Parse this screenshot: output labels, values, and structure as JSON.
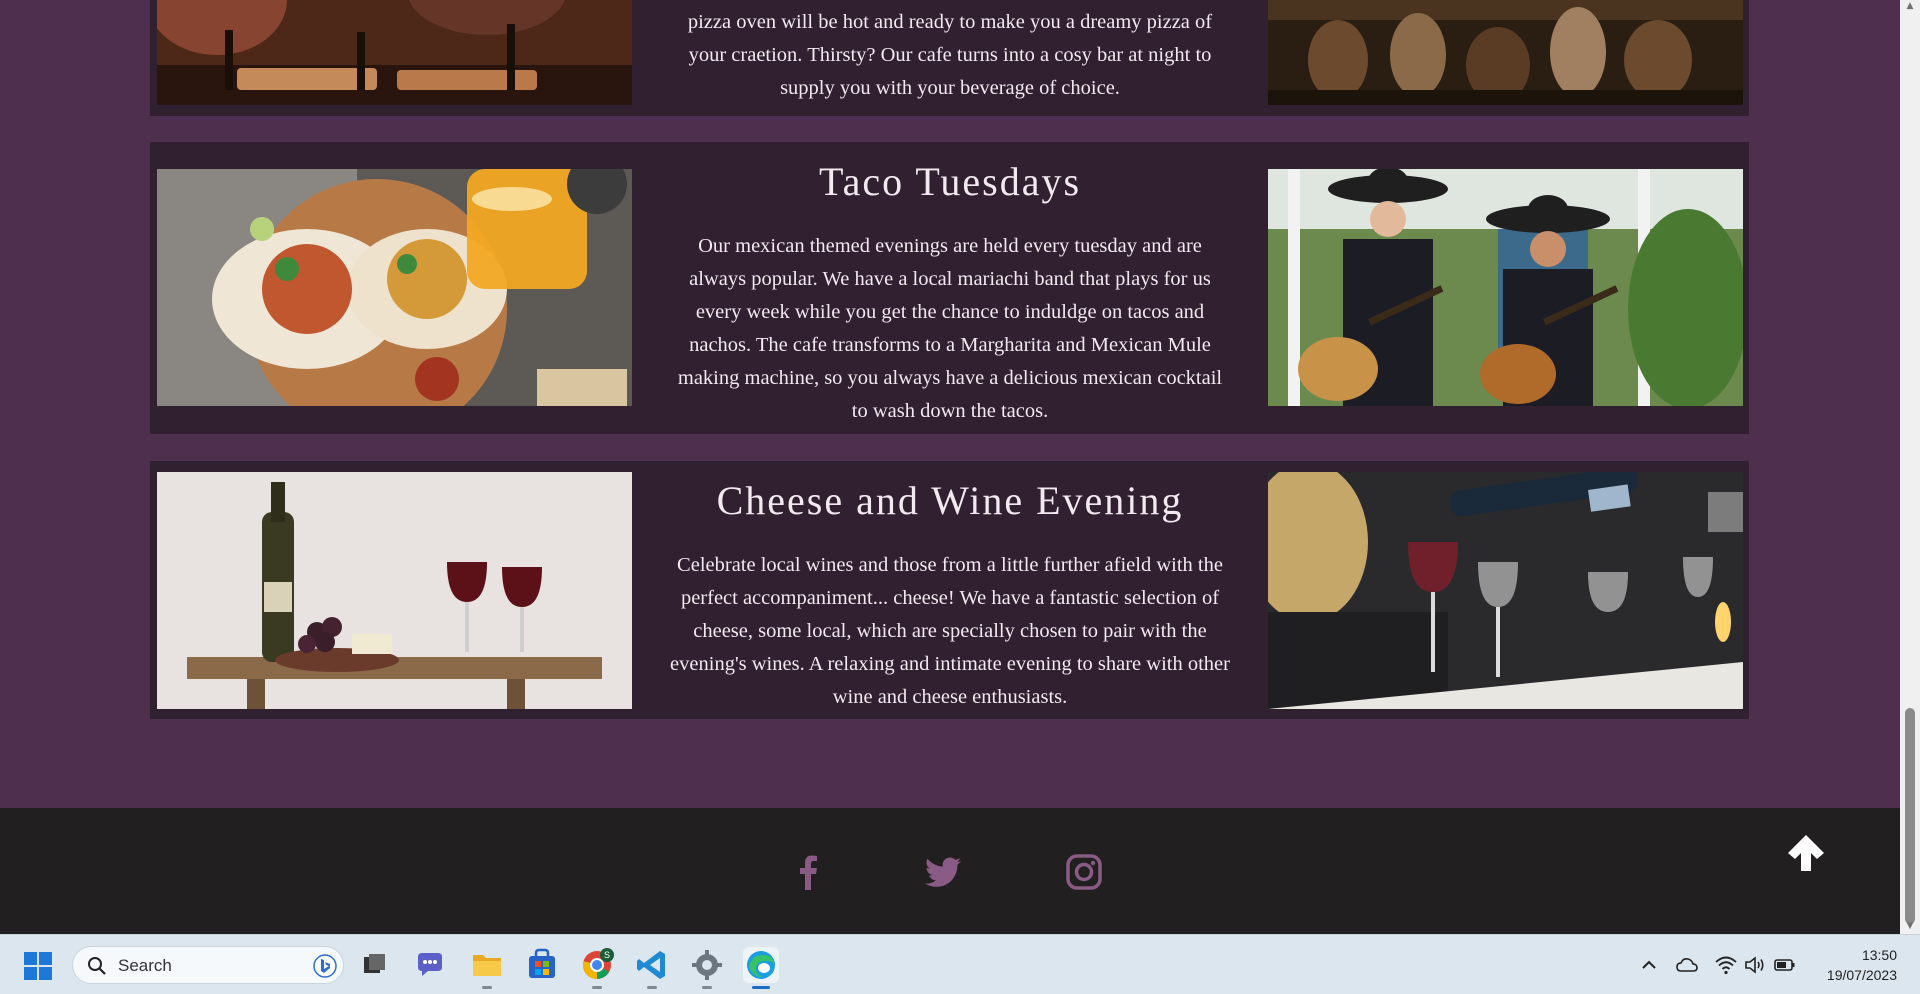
{
  "events": [
    {
      "title": "",
      "description": "pizza oven will be hot and ready to make you a dreamy pizza of your craetion. Thirsty? Our cafe turns into a cosy bar at night to supply you with your beverage of choice.",
      "left_image": "pizza-night-dinner-photo",
      "right_image": "busy-bar-crowd-photo"
    },
    {
      "title": "Taco Tuesdays",
      "description": "Our mexican themed evenings are held every tuesday and are always popular. We have a local mariachi band that plays for us every week while you get the chance to induldge on tacos and nachos. The cafe transforms to a Margharita and Mexican Mule making machine, so you always have a delicious mexican cocktail to wash down the tacos.",
      "left_image": "tacos-and-cocktail-photo",
      "right_image": "mariachi-band-photo"
    },
    {
      "title": "Cheese and Wine Evening",
      "description": "Celebrate local wines and those from a little further afield with the perfect accompaniment... cheese! We have a fantastic selection of cheese, some local, which are specially chosen to pair with the evening's wines. A relaxing and intimate evening to share with other wine and cheese enthusiasts.",
      "left_image": "wine-bottle-and-grapes-photo",
      "right_image": "wine-pouring-photo"
    }
  ],
  "footer": {
    "social_icons": [
      "facebook-icon",
      "twitter-icon",
      "instagram-icon"
    ],
    "social_color": "#8a5b84",
    "back_to_top_icon": "arrow-up-icon"
  },
  "taskbar": {
    "search_placeholder": "Search",
    "pinned_apps": [
      "task-view-icon",
      "teams-chat-icon",
      "file-explorer-icon",
      "microsoft-store-icon",
      "chrome-icon",
      "vscode-icon",
      "settings-icon",
      "edge-icon"
    ],
    "time": "13:50",
    "date": "19/07/2023"
  },
  "colors": {
    "page_bg": "#4e2f4e",
    "card_bg": "#31202f",
    "footer_bg": "#221f21",
    "text": "#f2eaf0"
  }
}
